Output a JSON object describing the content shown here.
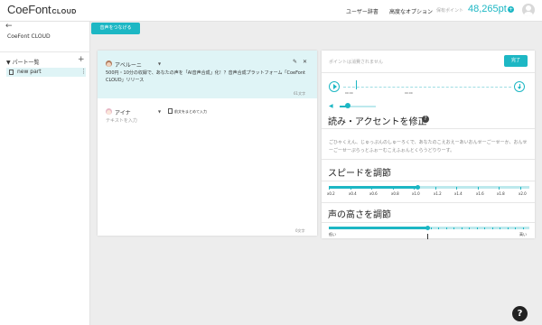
{
  "header": {
    "logo_main": "CoeFont",
    "logo_sub": "CLOUD",
    "nav_dictionary": "ユーザー辞書",
    "nav_options": "高度なオプション",
    "points_label": "保有ポイント",
    "points_value": "48,265pt",
    "points_plus": "+"
  },
  "sidebar": {
    "back": "←",
    "project_name": "CoeFont CLOUD",
    "parts_header": "▼ パート一覧",
    "add": "+",
    "parts": [
      {
        "label": "new part",
        "more": "⋮"
      }
    ]
  },
  "toolbar": {
    "connect_label": "音声をつなげる"
  },
  "editor": {
    "blocks": [
      {
        "speaker": "アベルーニ",
        "text": "500円・10分の収録で、あなたの声を「AI音声合成」化！？音声合成プラットフォーム「CoeFont CLOUD」リリース",
        "char_count": "61文字"
      },
      {
        "speaker": "アイナ",
        "merge_label": "前文をまとめて入力",
        "placeholder": "テキストを入力",
        "char_count": "0文字"
      }
    ],
    "dropdown_arrow": "▼",
    "edit_icon": "✎",
    "close_icon": "✕"
  },
  "panel": {
    "notice": "ポイントは消費されません",
    "done_label": "完了",
    "time_start": "00:00",
    "time_end": "00:00",
    "volume_icon": "◀",
    "volume_level": 0.25,
    "accent_title": "読み・アクセントを修正",
    "help_glyph": "?",
    "kana_text": "ごひゃくえん、じゅっぷんのしゅーろくで、あなたのこえおえーあいおんせーごーせーか、おんせーごーせーぷらっとふぉーむこえふぉんとくらうどりりーす。",
    "speed": {
      "title": "スピードを調節",
      "ticks": [
        "x0.2",
        "x0.4",
        "x0.6",
        "x0.8",
        "x1.0",
        "x1.2",
        "x1.4",
        "x1.6",
        "x1.8",
        "x2.0"
      ],
      "value": "x1.0"
    },
    "pitch": {
      "title": "声の高さを調節",
      "low": "低い",
      "high": "高い",
      "value": 0.5
    }
  },
  "fab": {
    "help": "?"
  },
  "colors": {
    "accent": "#1db7c4",
    "selected_bg": "#dff4f6",
    "track": "#bde9ed"
  }
}
